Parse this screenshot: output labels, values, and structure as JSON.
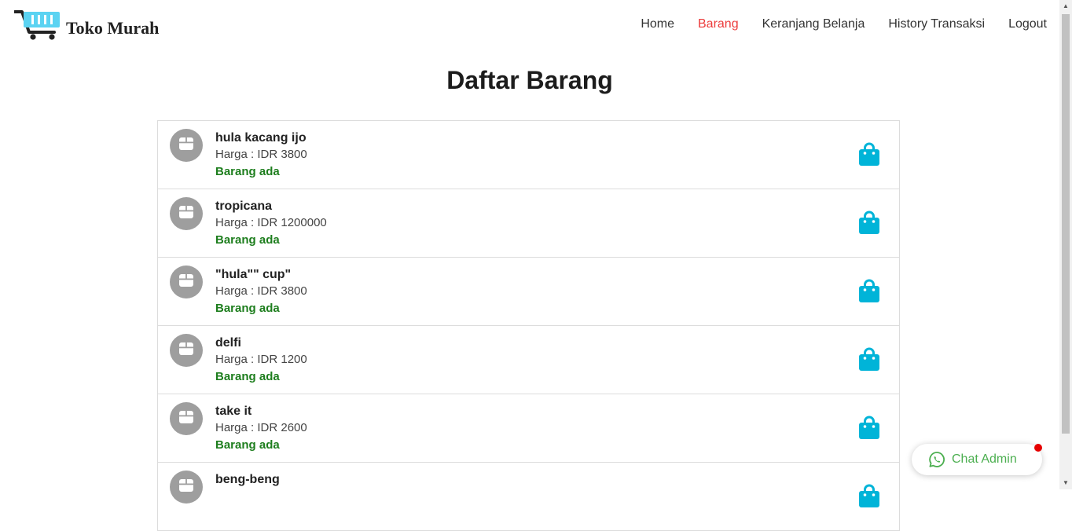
{
  "brand": {
    "name": "Toko Murah",
    "icon": "shopping-cart-logo"
  },
  "nav": {
    "items": [
      {
        "label": "Home",
        "active": false
      },
      {
        "label": "Barang",
        "active": true
      },
      {
        "label": "Keranjang Belanja",
        "active": false
      },
      {
        "label": "History Transaksi",
        "active": false
      },
      {
        "label": "Logout",
        "active": false
      }
    ]
  },
  "page": {
    "title": "Daftar Barang"
  },
  "products": [
    {
      "name": "hula kacang ijo",
      "price": "Harga : IDR 3800",
      "status": "Barang ada"
    },
    {
      "name": "tropicana",
      "price": "Harga : IDR 1200000",
      "status": "Barang ada"
    },
    {
      "name": "\"hula\"\" cup\"",
      "price": "Harga : IDR 3800",
      "status": "Barang ada"
    },
    {
      "name": "delfi",
      "price": "Harga : IDR 1200",
      "status": "Barang ada"
    },
    {
      "name": "take it",
      "price": "Harga : IDR 2600",
      "status": "Barang ada"
    },
    {
      "name": "beng-beng",
      "price": "",
      "status": ""
    }
  ],
  "chat": {
    "label": "Chat Admin",
    "icon": "whatsapp-icon"
  },
  "colors": {
    "accent_active": "#ec3b3b",
    "stock_green": "#1e7e1e",
    "cart_cyan": "#00b4d8",
    "chat_green": "#4caf50",
    "logo_cyan": "#5bd3f2"
  }
}
